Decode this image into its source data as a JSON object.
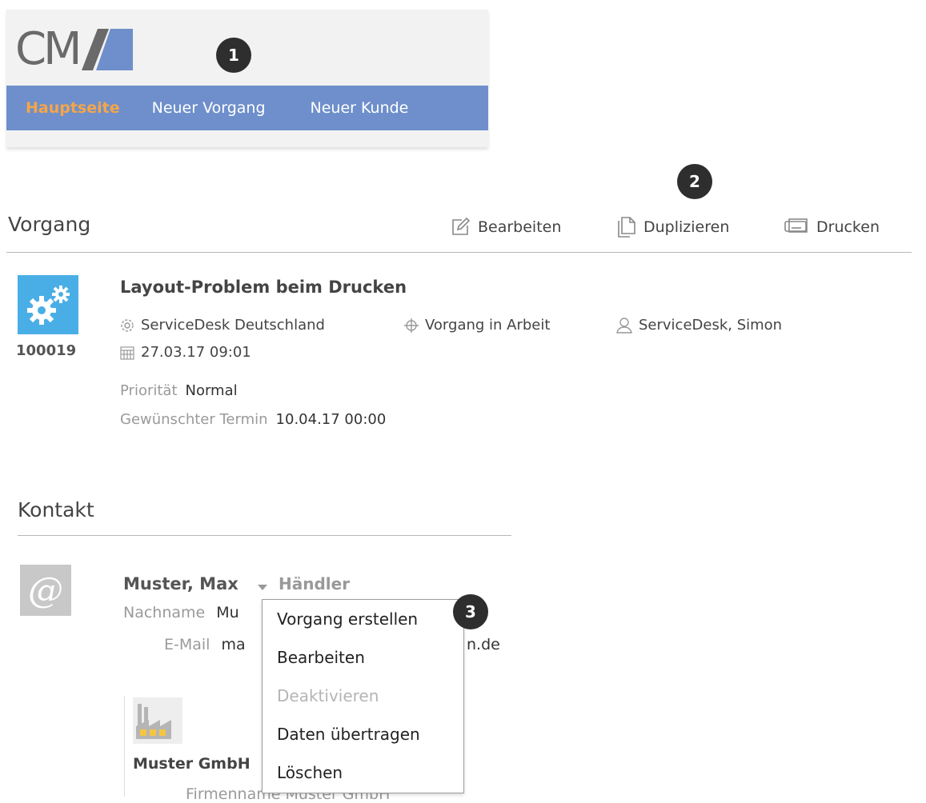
{
  "header": {
    "logo_text": "CM",
    "nav": [
      {
        "label": "Hauptseite",
        "active": true
      },
      {
        "label": "Neuer Vorgang",
        "active": false
      },
      {
        "label": "Neuer Kunde",
        "active": false
      }
    ],
    "active_color": "#f5a54a",
    "nav_bg": "#6e8fcb"
  },
  "callouts": [
    "1",
    "2",
    "3"
  ],
  "vorgang": {
    "section_title": "Vorgang",
    "toolbar": {
      "edit_label": "Bearbeiten",
      "duplicate_label": "Duplizieren",
      "print_label": "Drucken"
    },
    "case_id": "100019",
    "title": "Layout-Problem beim Drucken",
    "team": "ServiceDesk Deutschland",
    "status": "Vorgang in Arbeit",
    "assignee": "ServiceDesk, Simon",
    "created": "27.03.17 09:01",
    "priority_label": "Priorität",
    "priority_value": "Normal",
    "due_label": "Gewünschter Termin",
    "due_value": "10.04.17 00:00",
    "icon": "gears-icon"
  },
  "kontakt": {
    "section_title": "Kontakt",
    "name": "Muster, Max",
    "role": "Händler",
    "lastname_label": "Nachname",
    "lastname_value_visible": "Mu",
    "email_label": "E-Mail",
    "email_value_visible_start": "ma",
    "email_value_visible_end": "n.de",
    "company_name_visible": "Muster GmbH",
    "company_field_visible": "Firmenname   Muster GmbH",
    "icon": "at-sign-icon",
    "company_icon": "factory-icon"
  },
  "context_menu": {
    "items": [
      {
        "label": "Vorgang erstellen",
        "enabled": true
      },
      {
        "label": "Bearbeiten",
        "enabled": true
      },
      {
        "label": "Deaktivieren",
        "enabled": false
      },
      {
        "label": "Daten übertragen",
        "enabled": true
      },
      {
        "label": "Löschen",
        "enabled": true
      }
    ]
  }
}
